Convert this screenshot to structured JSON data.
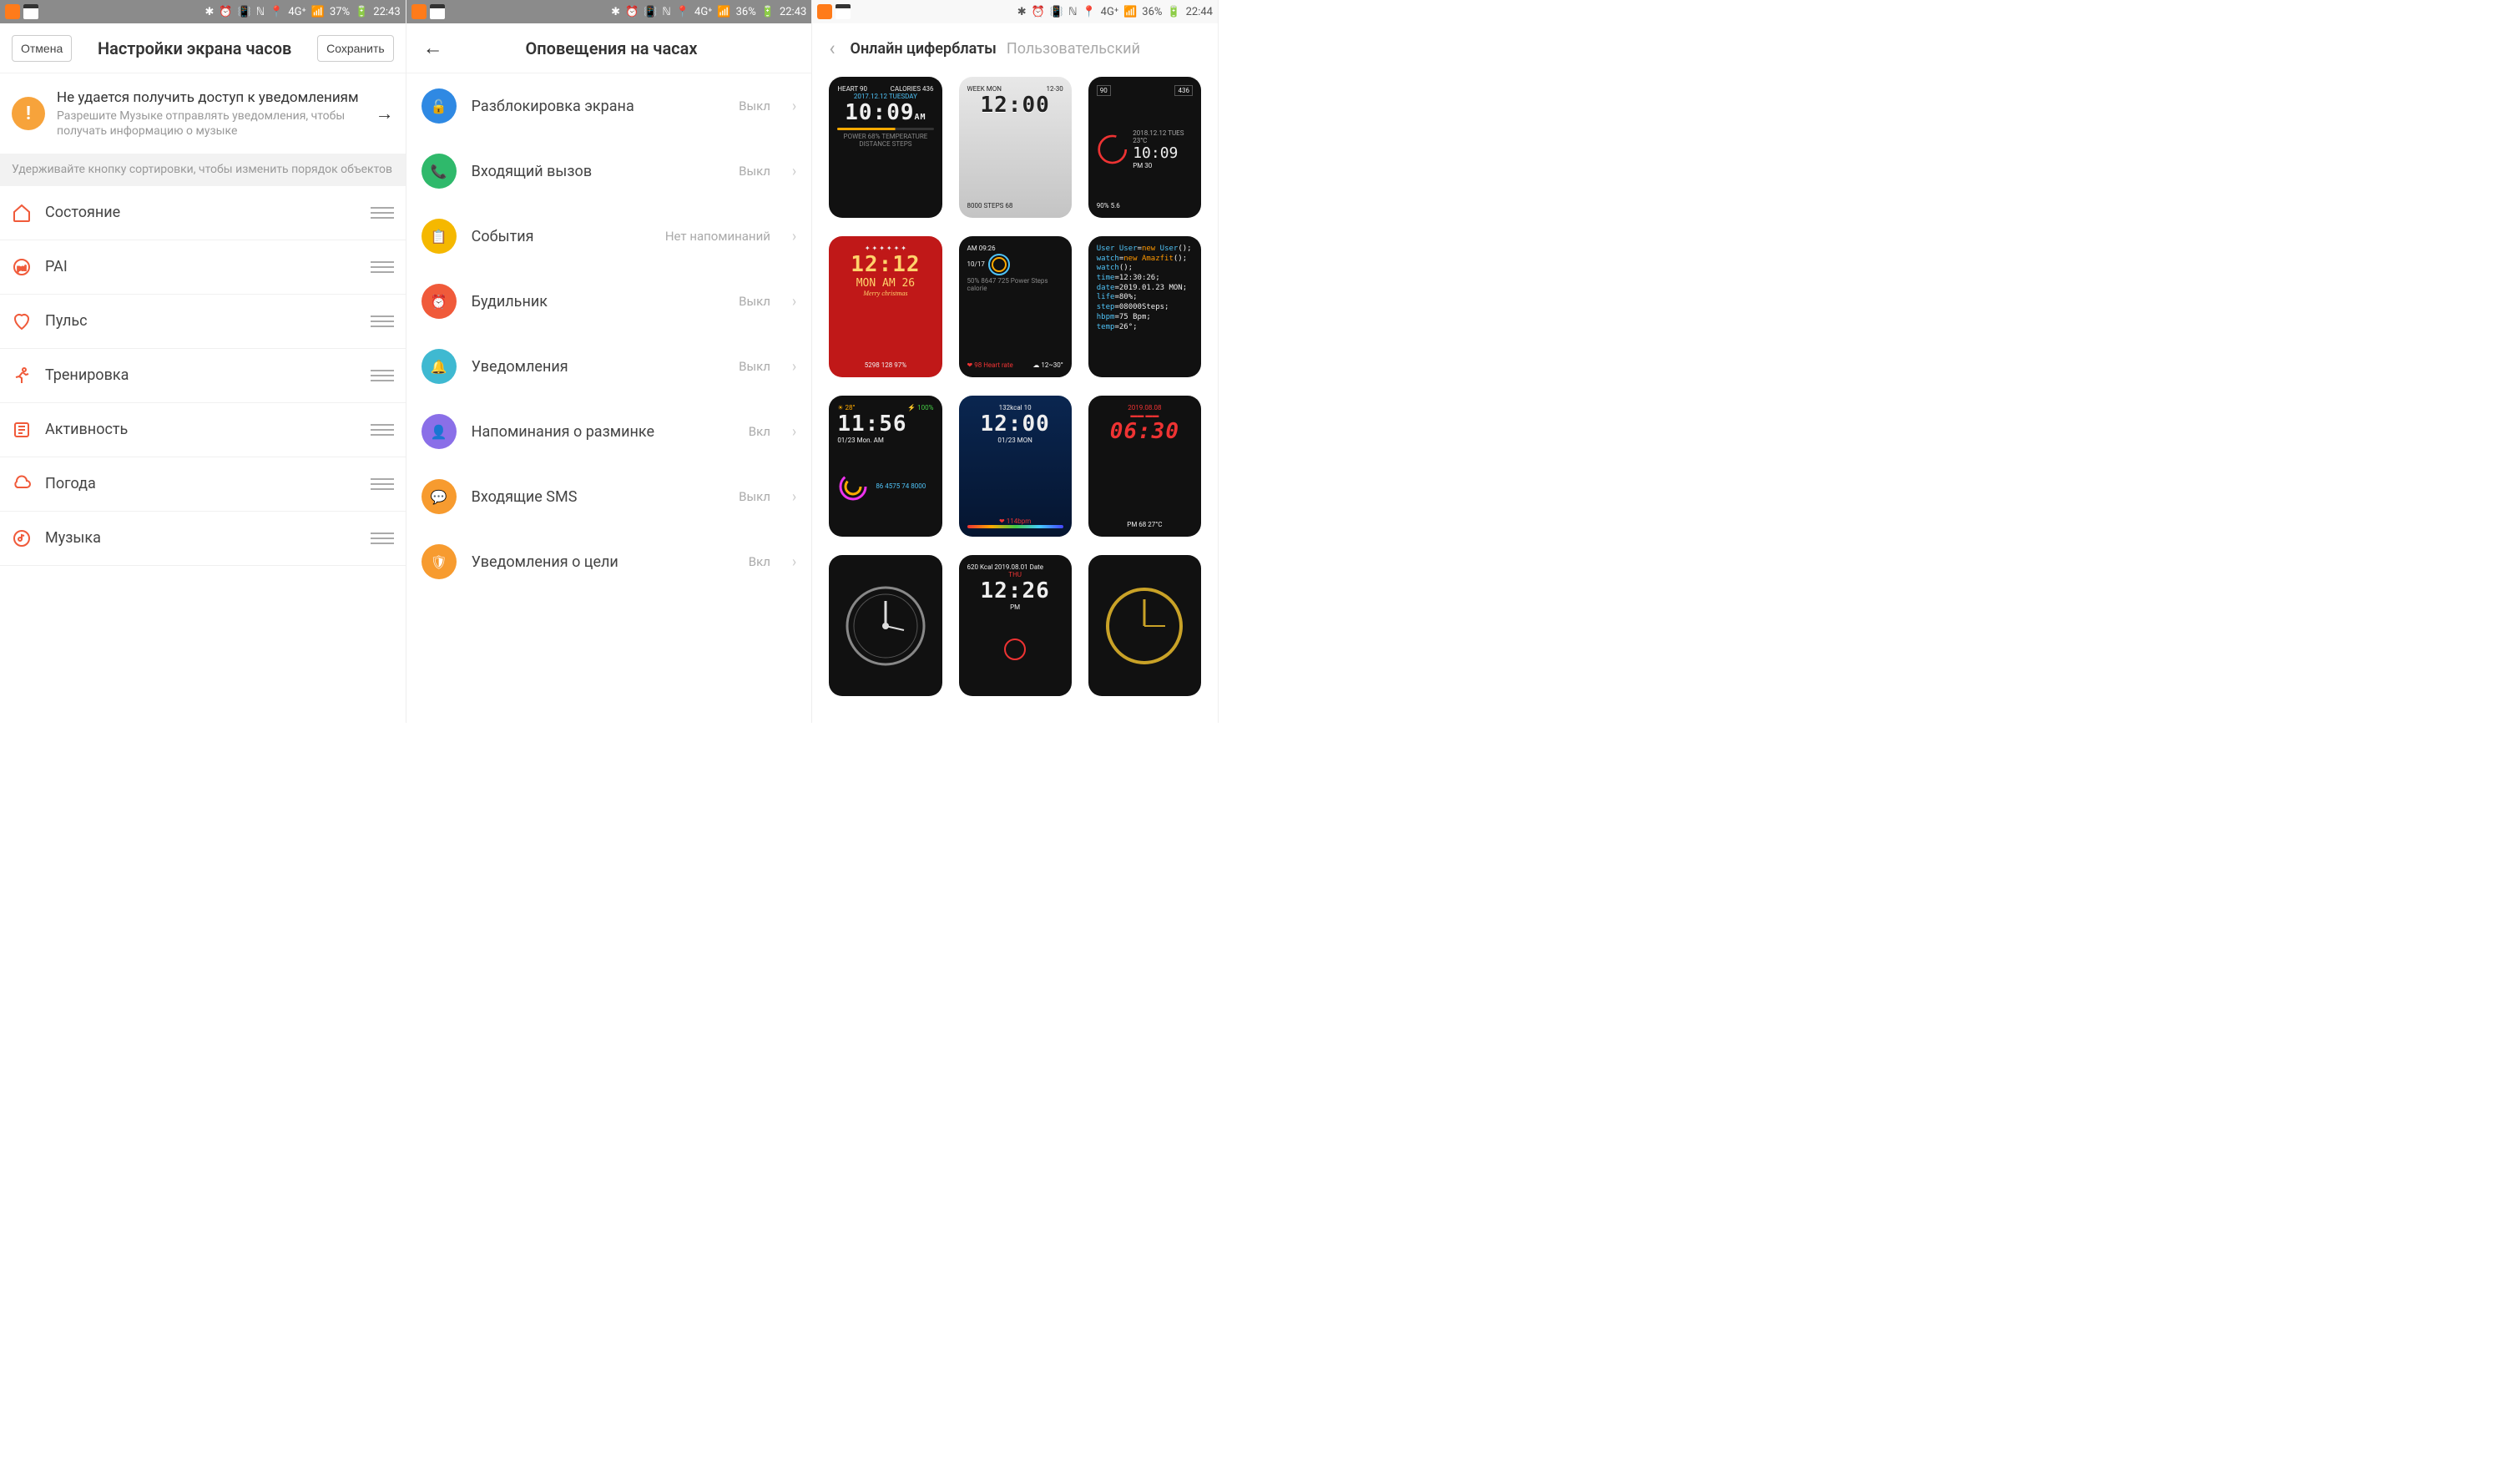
{
  "screen1": {
    "status": {
      "battery": "37%",
      "time": "22:43"
    },
    "header": {
      "cancel": "Отмена",
      "title": "Настройки экрана часов",
      "save": "Сохранить"
    },
    "warning": {
      "title": "Не удается получить доступ к уведомлениям",
      "sub": "Разрешите Музыке отправлять уведомления, чтобы получать информацию о музыке"
    },
    "hint": "Удерживайте кнопку сортировки, чтобы изменить порядок объектов",
    "items": [
      {
        "label": "Состояние"
      },
      {
        "label": "PAI"
      },
      {
        "label": "Пульс"
      },
      {
        "label": "Тренировка"
      },
      {
        "label": "Активность"
      },
      {
        "label": "Погода"
      },
      {
        "label": "Музыка"
      }
    ]
  },
  "screen2": {
    "status": {
      "battery": "36%",
      "time": "22:43"
    },
    "title": "Оповещения на часах",
    "states": {
      "on": "Вкл",
      "off": "Выкл",
      "none": "Нет напоминаний"
    },
    "items": [
      {
        "label": "Разблокировка экрана",
        "state": "Выкл",
        "color": "#2f89e3",
        "glyph": "🔓"
      },
      {
        "label": "Входящий вызов",
        "state": "Выкл",
        "color": "#2fb96b",
        "glyph": "📞"
      },
      {
        "label": "События",
        "state": "Нет напоминаний",
        "color": "#f5b800",
        "glyph": "📋"
      },
      {
        "label": "Будильник",
        "state": "Выкл",
        "color": "#f05a3a",
        "glyph": "⏰"
      },
      {
        "label": "Уведомления",
        "state": "Выкл",
        "color": "#3fb9d1",
        "glyph": "🔔"
      },
      {
        "label": "Напоминания о разминке",
        "state": "Вкл",
        "color": "#8a6fe8",
        "glyph": "👤"
      },
      {
        "label": "Входящие SMS",
        "state": "Выкл",
        "color": "#f79b2f",
        "glyph": "💬"
      },
      {
        "label": "Уведомления о цели",
        "state": "Вкл",
        "color": "#f79b2f",
        "glyph": "🛡"
      }
    ]
  },
  "screen3": {
    "status": {
      "battery": "36%",
      "time": "22:44"
    },
    "tabs": {
      "active": "Онлайн циферблаты",
      "inactive": "Пользовательский"
    },
    "faces": [
      {
        "top_l": "HEART 90",
        "top_r": "CALORIES 436",
        "date": "2017.12.12 TUESDAY",
        "time": "10:09",
        "ampm": "AM",
        "bottom": "POWER 68%  TEMPERATURE  DISTANCE  STEPS"
      },
      {
        "style": "silver",
        "top_l": "WEEK MON",
        "top_r": "12-30",
        "time": "12:00",
        "bottom": "8000 STEPS  68"
      },
      {
        "top_l": "90",
        "top_r": "436",
        "date": "2018.12.12 TUES 23°C",
        "time": "10:09",
        "sub": "PM 30",
        "bottom": "90%  5.6"
      },
      {
        "style": "red",
        "time": "12:12",
        "date": "MON AM 26",
        "label": "Merry christmas",
        "bottom": "5298  128  97%"
      },
      {
        "time_top": "AM 09:26",
        "date": "10/17",
        "stats": "50% 8647 725 Power Steps calorie",
        "hr": "98 Heart rate",
        "weather": "12~30°"
      },
      {
        "style": "code",
        "lines": [
          "User User=new User();",
          "watch=new Amazfit();",
          "watch();",
          "time=12:30:26;",
          "date=2019.01.23 MON;",
          "life=80%;",
          "step=08000Steps;",
          "hbpm=75 Bpm;",
          "temp=26°;"
        ]
      },
      {
        "temp": "28°",
        "batt": "100%",
        "time": "11:56",
        "date": "01/23 Mon. AM",
        "stats": "86 4575 74 8000"
      },
      {
        "style": "blue",
        "top": "132kcal  10",
        "time": "12:00",
        "date": "01/23 MON",
        "bottom": "114bpm"
      },
      {
        "date_top": "2019.08.08",
        "time": "06:30",
        "sub": "PM 68  27°C"
      },
      {
        "style": "analog"
      },
      {
        "top": "620 Kcal  2019.08.01 Date",
        "day": "THU",
        "time": "12:26",
        "sub": "PM"
      },
      {
        "style": "gold"
      }
    ]
  }
}
